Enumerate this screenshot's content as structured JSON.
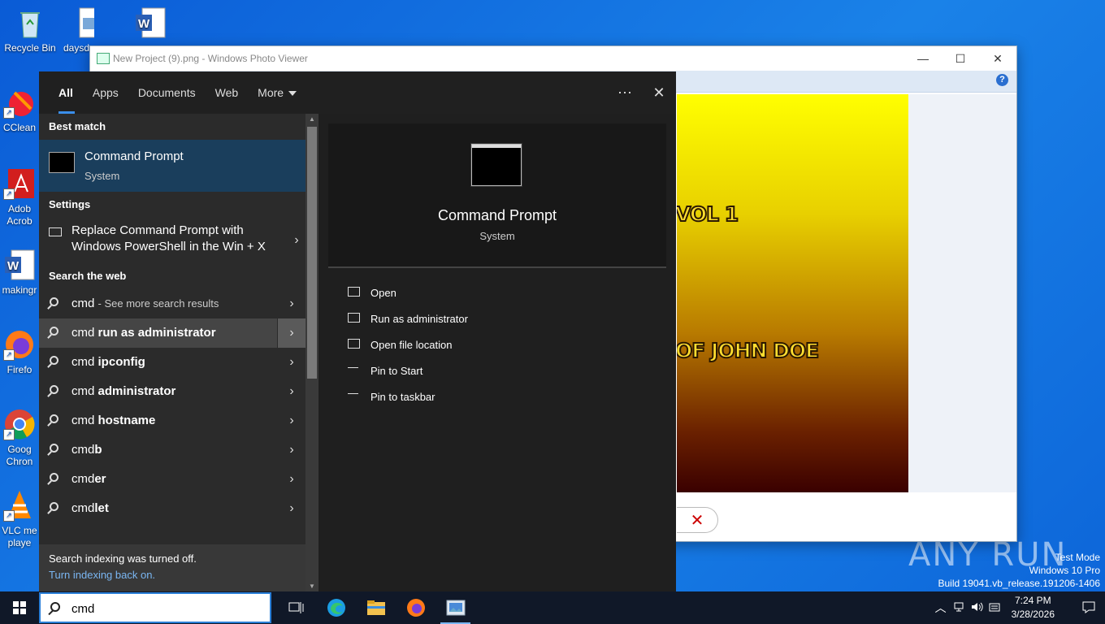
{
  "desktop": {
    "icons": [
      {
        "label": "Recycle Bin",
        "icon": "recycle-bin-icon"
      },
      {
        "label": "daysd",
        "icon": "image-file-icon"
      },
      {
        "label": "",
        "icon": "word-doc-icon"
      },
      {
        "label": "CClean",
        "icon": "ccleaner-icon"
      },
      {
        "label": "Adob Acrob",
        "icon": "acrobat-icon"
      },
      {
        "label": "makingr",
        "icon": "word-doc-icon"
      },
      {
        "label": "Firefo",
        "icon": "firefox-icon"
      },
      {
        "label": "Goog Chron",
        "icon": "chrome-icon"
      },
      {
        "label": "VLC me playe",
        "icon": "vlc-icon"
      }
    ]
  },
  "photo_viewer": {
    "title": "New Project (9).png - Windows Photo Viewer",
    "picture_text": [
      "VOL 1",
      "OF JOHN DOE"
    ],
    "controls": {
      "minimize": "—",
      "maximize": "☐",
      "close": "✕"
    },
    "help": "?",
    "delete_symbol": "✕"
  },
  "search": {
    "tabs": [
      "All",
      "Apps",
      "Documents",
      "Web",
      "More"
    ],
    "more_menu": "⋯",
    "close": "✕",
    "best_match_heading": "Best match",
    "best_match": {
      "name": "Command Prompt",
      "type": "System"
    },
    "settings_heading": "Settings",
    "settings_item": "Replace Command Prompt with Windows PowerShell in the Win + X",
    "web_heading": "Search the web",
    "web_first": {
      "query": "cmd",
      "suffix": "- See more search results"
    },
    "web_suggestions": [
      {
        "prefix": "cmd ",
        "bold": "run as administrator"
      },
      {
        "prefix": "cmd ",
        "bold": "ipconfig"
      },
      {
        "prefix": "cmd ",
        "bold": "administrator"
      },
      {
        "prefix": "cmd ",
        "bold": "hostname"
      },
      {
        "prefix": "cmd",
        "bold": "b"
      },
      {
        "prefix": "cmd",
        "bold": "er"
      },
      {
        "prefix": "cmd",
        "bold": "let"
      }
    ],
    "footer_note": "Search indexing was turned off.",
    "footer_link": "Turn indexing back on.",
    "preview": {
      "name": "Command Prompt",
      "type": "System",
      "actions": [
        "Open",
        "Run as administrator",
        "Open file location",
        "Pin to Start",
        "Pin to taskbar"
      ]
    }
  },
  "taskbar": {
    "search_value": "cmd",
    "time": "7:24 PM",
    "date": "3/28/2026",
    "apps": [
      "task-view-icon",
      "edge-icon",
      "file-explorer-icon",
      "firefox-icon",
      "photo-viewer-icon"
    ]
  },
  "watermark": {
    "line1": "Test Mode",
    "line2": "Windows 10 Pro",
    "line3": "Build 19041.vb_release.191206-1406",
    "brand": "ANY RUN"
  }
}
